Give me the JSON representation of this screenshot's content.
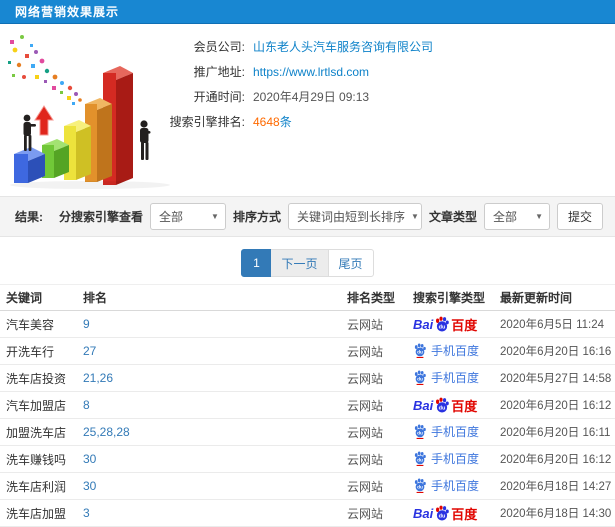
{
  "header": {
    "title": "网络营销效果展示"
  },
  "info": {
    "company_label": "会员公司:",
    "company_value": "山东老人头汽车服务咨询有限公司",
    "url_label": "推广地址:",
    "url_value": "https://www.lrtlsd.com",
    "opened_label": "开通时间:",
    "opened_value": "2020年4月29日 09:13",
    "rank_label": "搜索引擎排名:",
    "rank_count": "4648",
    "rank_unit": "条"
  },
  "filters": {
    "section_label": "结果:",
    "engine_label": "分搜索引擎查看",
    "engine_value": "全部",
    "sort_label": "排序方式",
    "sort_value": "关键词由短到长排序",
    "article_label": "文章类型",
    "article_value": "全部",
    "submit_label": "提交"
  },
  "pagination": {
    "current": "1",
    "next": "下一页",
    "last": "尾页"
  },
  "table": {
    "headers": [
      "关键词",
      "排名",
      "排名类型",
      "搜索引擎类型",
      "最新更新时间"
    ],
    "rows": [
      {
        "keyword": "汽车美容",
        "rank": "9",
        "rank_type": "云网站",
        "engine": "baidu",
        "updated": "2020年6月5日 11:24"
      },
      {
        "keyword": "开洗车行",
        "rank": "27",
        "rank_type": "云网站",
        "engine": "mobile_baidu",
        "updated": "2020年6月20日 16:16"
      },
      {
        "keyword": "洗车店投资",
        "rank": "21,26",
        "rank_type": "云网站",
        "engine": "mobile_baidu",
        "updated": "2020年5月27日 14:58"
      },
      {
        "keyword": "汽车加盟店",
        "rank": "8",
        "rank_type": "云网站",
        "engine": "baidu",
        "updated": "2020年6月20日 16:12"
      },
      {
        "keyword": "加盟洗车店",
        "rank": "25,28,28",
        "rank_type": "云网站",
        "engine": "mobile_baidu",
        "updated": "2020年6月20日 16:11"
      },
      {
        "keyword": "洗车赚钱吗",
        "rank": "30",
        "rank_type": "云网站",
        "engine": "mobile_baidu",
        "updated": "2020年6月20日 16:12"
      },
      {
        "keyword": "洗车店利润",
        "rank": "30",
        "rank_type": "云网站",
        "engine": "mobile_baidu",
        "updated": "2020年6月18日 14:27"
      },
      {
        "keyword": "洗车店加盟",
        "rank": "3",
        "rank_type": "云网站",
        "engine": "baidu",
        "updated": "2020年6月18日 14:30"
      }
    ]
  },
  "engines": {
    "baidu": {
      "prefix": "Bai",
      "du": "du",
      "suffix": "百度"
    },
    "mobile_baidu": {
      "du": "du",
      "label": "手机百度"
    }
  },
  "colors": {
    "header_bg": "#1887d2",
    "link_blue": "#0e82c9",
    "accent_blue": "#337ab7",
    "highlight_orange": "#ff6a00",
    "baidu_blue": "#2932e1",
    "baidu_red": "#e10601",
    "mobile_baidu_blue": "#3e76dd"
  }
}
